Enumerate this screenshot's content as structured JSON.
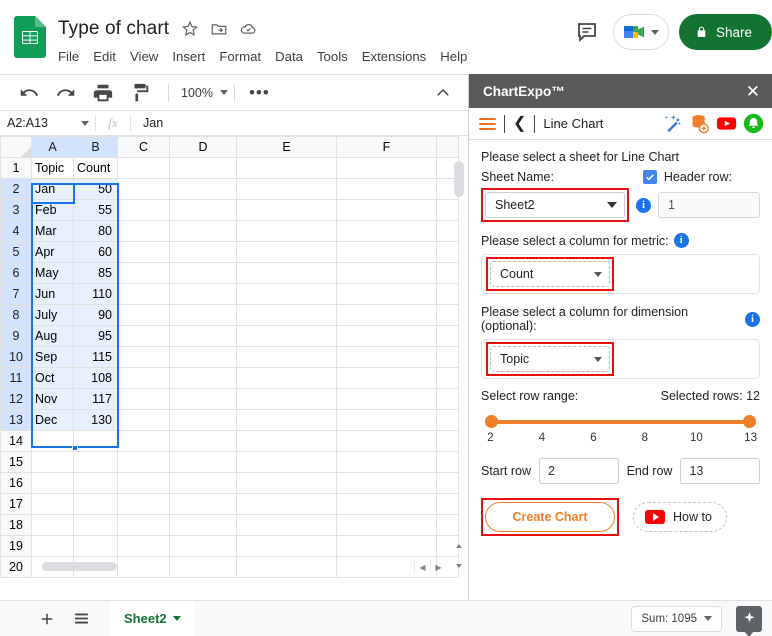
{
  "doc": {
    "title": "Type of chart",
    "icons": [
      "star-icon",
      "move-to-folder-icon",
      "cloud-saved-icon"
    ]
  },
  "menubar": [
    "File",
    "Edit",
    "View",
    "Insert",
    "Format",
    "Data",
    "Tools",
    "Extensions",
    "Help"
  ],
  "header_right": {
    "comment_icon": "comment-icon",
    "meet_icon": "google-meet-icon",
    "share_label": "Share",
    "share_color": "#137333"
  },
  "toolbar": {
    "icons": [
      "undo-icon",
      "redo-icon",
      "print-icon",
      "paint-format-icon"
    ],
    "zoom": "100%",
    "more_label": "•••"
  },
  "formula_bar": {
    "name_box": "A2:A13",
    "fx_label": "fx",
    "formula_value": "Jan"
  },
  "grid": {
    "columns": [
      "A",
      "B",
      "C",
      "D",
      "E",
      "F",
      ""
    ],
    "headers": [
      "Topic",
      "Count"
    ],
    "rows": [
      {
        "n": "1",
        "topic": "Topic",
        "count": "Count"
      },
      {
        "n": "2",
        "topic": "Jan",
        "count": "50"
      },
      {
        "n": "3",
        "topic": "Feb",
        "count": "55"
      },
      {
        "n": "4",
        "topic": "Mar",
        "count": "80"
      },
      {
        "n": "5",
        "topic": "Apr",
        "count": "60"
      },
      {
        "n": "6",
        "topic": "May",
        "count": "85"
      },
      {
        "n": "7",
        "topic": "Jun",
        "count": "110"
      },
      {
        "n": "8",
        "topic": "July",
        "count": "90"
      },
      {
        "n": "9",
        "topic": "Aug",
        "count": "95"
      },
      {
        "n": "10",
        "topic": "Sep",
        "count": "115"
      },
      {
        "n": "11",
        "topic": "Oct",
        "count": "108"
      },
      {
        "n": "12",
        "topic": "Nov",
        "count": "117"
      },
      {
        "n": "13",
        "topic": "Dec",
        "count": "130"
      },
      {
        "n": "14",
        "topic": "",
        "count": ""
      },
      {
        "n": "15",
        "topic": "",
        "count": ""
      },
      {
        "n": "16",
        "topic": "",
        "count": ""
      },
      {
        "n": "17",
        "topic": "",
        "count": ""
      },
      {
        "n": "18",
        "topic": "",
        "count": ""
      },
      {
        "n": "19",
        "topic": "",
        "count": ""
      },
      {
        "n": "20",
        "topic": "",
        "count": ""
      }
    ]
  },
  "bottom_bar": {
    "add_sheet_icon": "plus-icon",
    "all_sheets_icon": "sheet-list-icon",
    "sheet_tab": "Sheet2",
    "sum_label": "Sum: 1095",
    "explore_icon": "explore-icon"
  },
  "panel": {
    "title": "ChartExpo™",
    "close_icon": "close-icon",
    "menu_icon": "hamburger-icon",
    "back_icon": "back-chevron-icon",
    "chart_name": "Line Chart",
    "toolbar_icons": [
      "magic-wand-icon",
      "data-source-add-icon",
      "youtube-icon",
      "notification-bell-icon"
    ],
    "sheet_prompt": "Please select a sheet for Line Chart",
    "sheet_name_label": "Sheet Name:",
    "sheet_name_value": "Sheet2",
    "header_row_label": "Header row:",
    "header_row_value": "1",
    "header_row_checked": true,
    "metric_prompt": "Please select a column for metric:",
    "metric_value": "Count",
    "dimension_prompt": "Please select a column for dimension (optional):",
    "dimension_value": "Topic",
    "row_range_label": "Select row range:",
    "selected_rows_label": "Selected rows: 12",
    "slider_ticks": [
      "2",
      "4",
      "6",
      "8",
      "10",
      "13"
    ],
    "start_row_label": "Start row",
    "start_row_value": "2",
    "end_row_label": "End row",
    "end_row_value": "13",
    "create_chart_label": "Create Chart",
    "how_to_label": "How to",
    "accent_color": "#f07f2d",
    "highlight_color": "#e8100f"
  },
  "chart_data": {
    "type": "table",
    "title": "Topic / Count",
    "categories": [
      "Jan",
      "Feb",
      "Mar",
      "Apr",
      "May",
      "Jun",
      "July",
      "Aug",
      "Sep",
      "Oct",
      "Nov",
      "Dec"
    ],
    "values": [
      50,
      55,
      80,
      60,
      85,
      110,
      90,
      95,
      115,
      108,
      117,
      130
    ],
    "xlabel": "Topic",
    "ylabel": "Count",
    "sum": 1095
  }
}
